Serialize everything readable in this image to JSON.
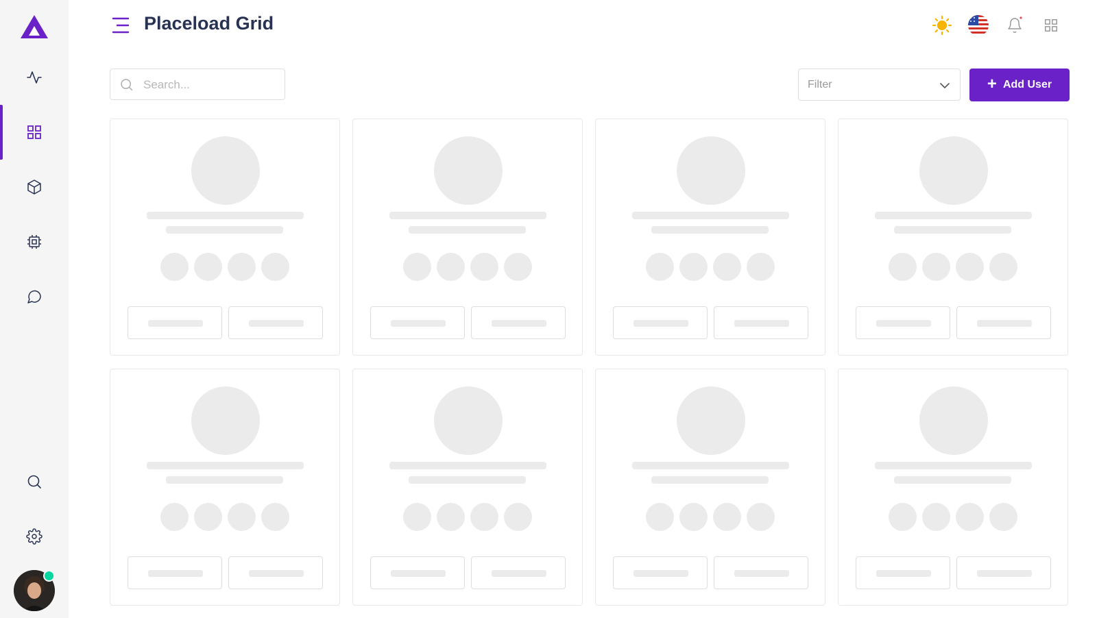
{
  "header": {
    "title": "Placeload Grid"
  },
  "toolbar": {
    "search_placeholder": "Search...",
    "filter_label": "Filter",
    "add_button_label": "Add User"
  },
  "colors": {
    "accent": "#6b21c8",
    "sun": "#f7b500",
    "online": "#06d6a0",
    "placeholder": "#ebebeb"
  },
  "sidebar": {
    "items": [
      {
        "icon": "activity-icon"
      },
      {
        "icon": "grid-icon",
        "active": true
      },
      {
        "icon": "box-icon"
      },
      {
        "icon": "cpu-icon"
      },
      {
        "icon": "message-icon"
      },
      {
        "icon": "search-icon"
      },
      {
        "icon": "settings-icon"
      }
    ]
  },
  "top_icons": [
    "sun-icon",
    "us-flag-icon",
    "bell-icon",
    "apps-grid-icon"
  ],
  "cards_count": 8
}
